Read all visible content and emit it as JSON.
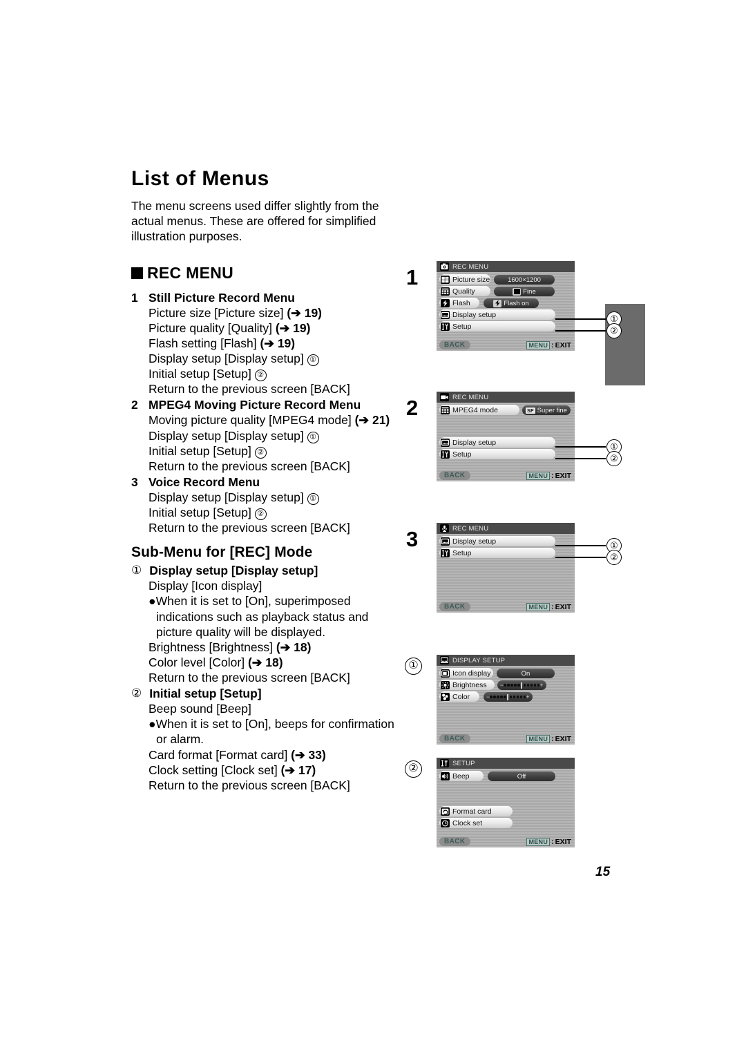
{
  "document": {
    "title": "List of Menus",
    "intro": "The menu screens used differ slightly from the actual menus. These are offered for simplified illustration purposes.",
    "page_number": "15"
  },
  "rec_menu_section": {
    "heading": "REC MENU",
    "items": [
      {
        "num": "1",
        "heading": "Still Picture Record Menu",
        "lines": [
          {
            "text": "Picture size [Picture size] ",
            "ref": "(➔ 19)",
            "circle": ""
          },
          {
            "text": "Picture quality [Quality] ",
            "ref": "(➔ 19)",
            "circle": ""
          },
          {
            "text": "Flash setting [Flash] ",
            "ref": "(➔ 19)",
            "circle": ""
          },
          {
            "text": "Display setup [Display setup] ",
            "ref": "",
            "circle": "1"
          },
          {
            "text": "Initial setup [Setup] ",
            "ref": "",
            "circle": "2"
          },
          {
            "text": "Return to the previous screen [BACK]",
            "ref": "",
            "circle": ""
          }
        ]
      },
      {
        "num": "2",
        "heading": "MPEG4 Moving Picture Record Menu",
        "lines": [
          {
            "text": "Moving picture quality [MPEG4 mode] ",
            "ref": "(➔ 21)",
            "circle": ""
          },
          {
            "text": "Display setup [Display setup] ",
            "ref": "",
            "circle": "1"
          },
          {
            "text": "Initial setup [Setup] ",
            "ref": "",
            "circle": "2"
          },
          {
            "text": "Return to the previous screen [BACK]",
            "ref": "",
            "circle": ""
          }
        ]
      },
      {
        "num": "3",
        "heading": "Voice Record Menu",
        "lines": [
          {
            "text": "Display setup [Display setup] ",
            "ref": "",
            "circle": "1"
          },
          {
            "text": "Initial setup [Setup] ",
            "ref": "",
            "circle": "2"
          },
          {
            "text": "Return to the previous screen [BACK]",
            "ref": "",
            "circle": ""
          }
        ]
      }
    ]
  },
  "submenu_section": {
    "heading": "Sub-Menu for [REC] Mode",
    "items": [
      {
        "circle": "1",
        "heading": "Display setup [Display setup]",
        "lines": [
          {
            "text": "Display [Icon display]",
            "ref": "",
            "circle": ""
          }
        ],
        "bullet": "●When it is set to [On], superimposed indications such as playback status and picture quality will be displayed.",
        "lines_after": [
          {
            "text": "Brightness [Brightness] ",
            "ref": "(➔ 18)",
            "circle": ""
          },
          {
            "text": "Color level [Color] ",
            "ref": "(➔ 18)",
            "circle": ""
          },
          {
            "text": "Return to the previous screen [BACK]",
            "ref": "",
            "circle": ""
          }
        ]
      },
      {
        "circle": "2",
        "heading": "Initial setup [Setup]",
        "lines": [
          {
            "text": "Beep sound [Beep]",
            "ref": "",
            "circle": ""
          }
        ],
        "bullet": "●When it is set to [On], beeps for confirmation or alarm.",
        "lines_after": [
          {
            "text": "Card format [Format card] ",
            "ref": "(➔ 33)",
            "circle": ""
          },
          {
            "text": "Clock setting [Clock set] ",
            "ref": "(➔ 17)",
            "circle": ""
          },
          {
            "text": "Return to the previous screen [BACK]",
            "ref": "",
            "circle": ""
          }
        ]
      }
    ]
  },
  "screens": {
    "common": {
      "back_label": "BACK",
      "menu_chip": "MENU",
      "exit_label": "EXIT",
      "exit_sep": ":"
    },
    "screen1": {
      "marker": "1",
      "title": "REC MENU",
      "title_icon": "still-camera-icon",
      "rows": [
        {
          "icon": "picture-size-icon",
          "label": "Picture size",
          "value": "1600×1200",
          "value_icon": ""
        },
        {
          "icon": "quality-icon",
          "label": "Quality",
          "value": "Fine",
          "value_icon": "quality-grid-icon"
        },
        {
          "icon": "flash-icon",
          "label": "Flash",
          "value": "Flash on",
          "value_icon": "flash-bolt-icon"
        },
        {
          "icon": "display-setup-icon",
          "label": "Display setup",
          "value": "",
          "value_icon": ""
        },
        {
          "icon": "setup-tools-icon",
          "label": "Setup",
          "value": "",
          "value_icon": ""
        }
      ],
      "callouts": [
        "1",
        "2"
      ]
    },
    "screen2": {
      "marker": "2",
      "title": "REC MENU",
      "title_icon": "movie-camera-icon",
      "rows": [
        {
          "icon": "quality-icon",
          "label": "MPEG4 mode",
          "value": "Super fine",
          "value_icon": "SF"
        },
        {
          "icon": "display-setup-icon",
          "label": "Display setup",
          "value": "",
          "value_icon": ""
        },
        {
          "icon": "setup-tools-icon",
          "label": "Setup",
          "value": "",
          "value_icon": ""
        }
      ],
      "callouts": [
        "1",
        "2"
      ]
    },
    "screen3": {
      "marker": "3",
      "title": "REC MENU",
      "title_icon": "microphone-icon",
      "rows": [
        {
          "icon": "display-setup-icon",
          "label": "Display setup",
          "value": "",
          "value_icon": ""
        },
        {
          "icon": "setup-tools-icon",
          "label": "Setup",
          "value": "",
          "value_icon": ""
        }
      ],
      "callouts": [
        "1",
        "2"
      ]
    },
    "screen4": {
      "marker": "1",
      "title": "DISPLAY SETUP",
      "title_icon": "display-setup-icon",
      "rows": [
        {
          "icon": "icon-display-icon",
          "label": "Icon display",
          "value": "On",
          "value_icon": ""
        },
        {
          "icon": "brightness-icon",
          "label": "Brightness",
          "value": "",
          "value_icon": "slider"
        },
        {
          "icon": "color-icon",
          "label": "Color",
          "value": "",
          "value_icon": "slider"
        }
      ],
      "slider_minus": "−",
      "slider_plus": "+"
    },
    "screen5": {
      "marker": "2",
      "title": "SETUP",
      "title_icon": "setup-tools-icon",
      "rows": [
        {
          "icon": "beep-icon",
          "label": "Beep",
          "value": "Off",
          "value_icon": ""
        },
        {
          "icon": "format-card-icon",
          "label": "Format card",
          "value": "",
          "value_icon": ""
        },
        {
          "icon": "clock-icon",
          "label": "Clock set",
          "value": "",
          "value_icon": ""
        }
      ]
    }
  }
}
